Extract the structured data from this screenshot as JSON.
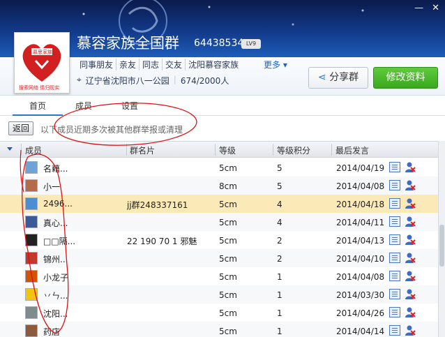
{
  "group": {
    "name": "慕容家族全国群",
    "id": "64438534",
    "level_badge": "LV9",
    "avatar_text": "慕思家族",
    "avatar_slogan": "搜索网络 情归现实",
    "tags": [
      "同事朋友",
      "亲友",
      "同志",
      "交友",
      "沈阳慕容家族"
    ],
    "more_label": "更多",
    "location": "辽宁省沈阳市八一公园",
    "members_count": "674/2000人"
  },
  "buttons": {
    "share": "分享群",
    "edit": "修改资料",
    "back": "返回"
  },
  "tabs": [
    {
      "label": "首页",
      "active": true
    },
    {
      "label": "成员",
      "active": false
    },
    {
      "label": "设置",
      "active": false
    }
  ],
  "notice": "以下成员近期多次被其他群举报或清理",
  "table": {
    "headers": {
      "member": "成员",
      "card": "群名片",
      "level": "等级",
      "points": "等级积分",
      "last": "最后发言"
    },
    "rows": [
      {
        "name": "名藉...",
        "card": "",
        "level": "5cm",
        "points": "5",
        "date": "2014/04/19",
        "avatar_color": "#6fa3d6"
      },
      {
        "name": "小一",
        "card": "",
        "level": "8cm",
        "points": "5",
        "date": "2014/04/08",
        "avatar_color": "#b56b4a"
      },
      {
        "name": "2496...",
        "card": "jj群248337161",
        "level": "5cm",
        "points": "4",
        "date": "2014/04/18",
        "avatar_color": "#4b8fd1"
      },
      {
        "name": "真心...",
        "card": "",
        "level": "5cm",
        "points": "4",
        "date": "2014/04/11",
        "avatar_color": "#3a5a9a"
      },
      {
        "name": "□□隔...",
        "card": "22 190 70 1 邪魅",
        "level": "5cm",
        "points": "2",
        "date": "2014/04/13",
        "avatar_color": "#222222"
      },
      {
        "name": "锦州...",
        "card": "",
        "level": "5cm",
        "points": "2",
        "date": "2014/04/10",
        "avatar_color": "#c0392b"
      },
      {
        "name": "小龙子",
        "card": "",
        "level": "5cm",
        "points": "1",
        "date": "2014/04/08",
        "avatar_color": "#d35400"
      },
      {
        "name": "丷ㄣ...",
        "card": "",
        "level": "5cm",
        "points": "1",
        "date": "2014/03/30",
        "avatar_color": "#f1c40f"
      },
      {
        "name": "沈阳...",
        "card": "",
        "level": "5cm",
        "points": "1",
        "date": "2014/04/26",
        "avatar_color": "#7f8c8d"
      },
      {
        "name": "药店",
        "card": "",
        "level": "5cm",
        "points": "1",
        "date": "2014/04/14",
        "avatar_color": "#8e5a3c"
      }
    ]
  }
}
